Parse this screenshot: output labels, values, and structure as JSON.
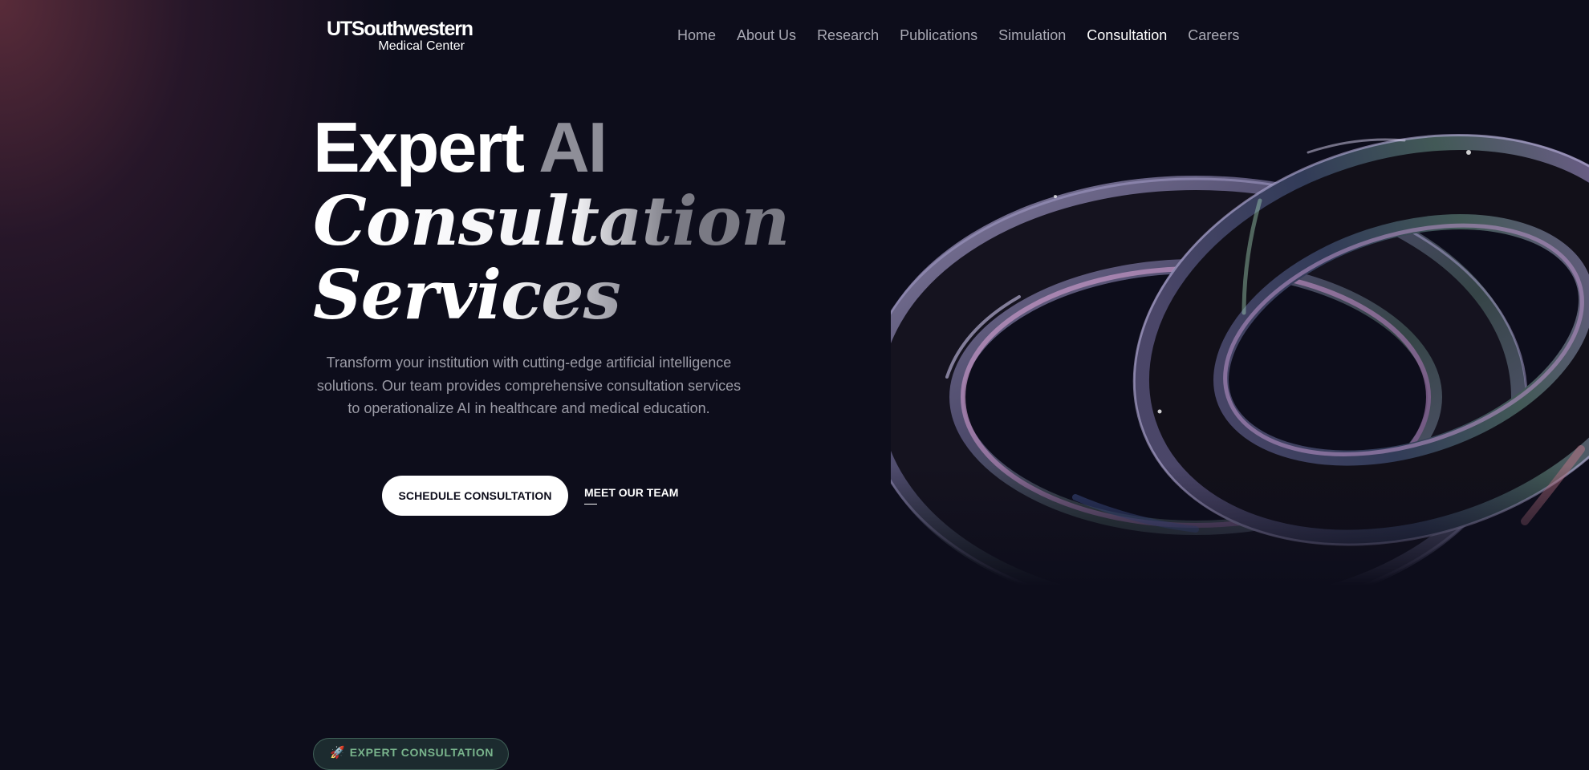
{
  "header": {
    "logo": {
      "line1": "UTSouthwestern",
      "line2": "Medical Center"
    },
    "nav": [
      {
        "label": "Home",
        "active": false
      },
      {
        "label": "About Us",
        "active": false
      },
      {
        "label": "Research",
        "active": false
      },
      {
        "label": "Publications",
        "active": false
      },
      {
        "label": "Simulation",
        "active": false
      },
      {
        "label": "Consultation",
        "active": true
      },
      {
        "label": "Careers",
        "active": false
      }
    ]
  },
  "hero": {
    "title_line1_a": "Expert ",
    "title_line1_b": "AI",
    "title_line2": "Consultation",
    "title_line3": "Services",
    "description": "Transform your institution with cutting-edge artificial intelligence solutions. Our team provides comprehensive consultation services to operationalize AI in healthcare and medical education.",
    "primary_cta": "SCHEDULE CONSULTATION",
    "secondary_cta": "MEET OUR TEAM",
    "art_icon": "torus-knot-3d-illustration"
  },
  "badge": {
    "icon": "rocket-icon",
    "icon_glyph": "🚀",
    "label": "EXPERT CONSULTATION"
  },
  "colors": {
    "background": "#0d0d1b",
    "text_primary": "#ffffff",
    "text_muted": "#9b9ba6",
    "nav_inactive": "#a9a9b4",
    "badge_text": "#79b48c",
    "glow": "#6e3442"
  }
}
